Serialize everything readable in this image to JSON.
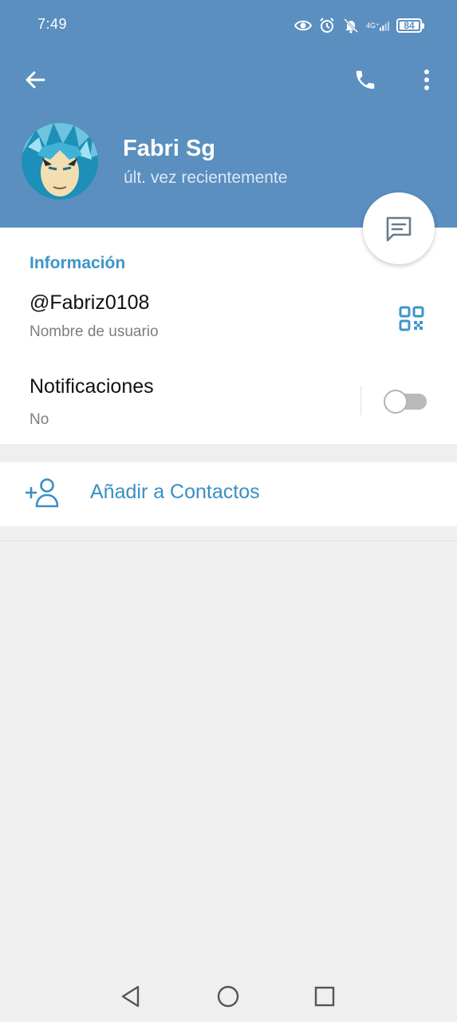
{
  "status_bar": {
    "time": "7:49",
    "network": "4G⁺",
    "battery": "84"
  },
  "profile": {
    "name": "Fabri Sg",
    "status": "últ. vez recientemente"
  },
  "info": {
    "section_title": "Información",
    "username": "@Fabriz0108",
    "username_label": "Nombre de usuario",
    "notifications_title": "Notificaciones",
    "notifications_value": "No",
    "notifications_enabled": false
  },
  "actions": {
    "add_contact": "Añadir a Contactos"
  },
  "colors": {
    "header": "#5a8fbf",
    "accent": "#3e95c9",
    "background": "#efefef"
  },
  "icons": {
    "back": "arrow-left-icon",
    "call": "phone-icon",
    "more": "more-vertical-icon",
    "message": "message-icon",
    "qr": "qr-code-icon",
    "add_contact": "add-person-icon"
  }
}
